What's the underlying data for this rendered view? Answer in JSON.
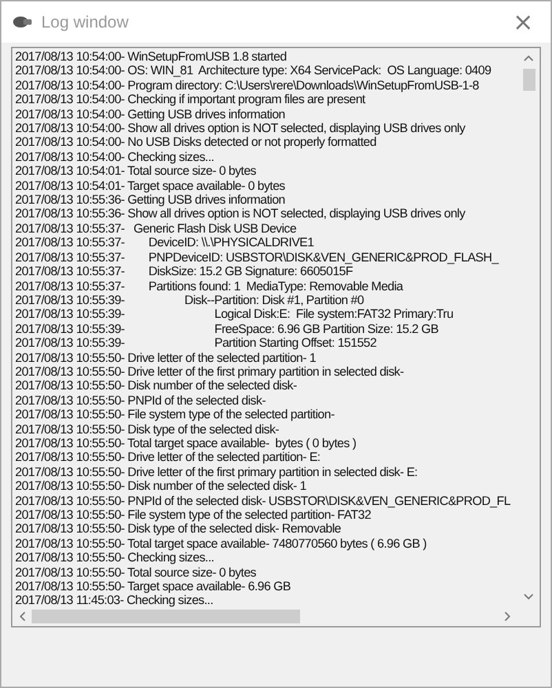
{
  "window": {
    "title": "Log window",
    "close_label": "×"
  },
  "log_lines": [
    "2017/08/13 10:54:00- WinSetupFromUSB 1.8 started",
    "2017/08/13 10:54:00- OS: WIN_81  Architecture type: X64 ServicePack:  OS Language: 0409",
    "2017/08/13 10:54:00- Program directory: C:\\Users\\rere\\Downloads\\WinSetupFromUSB-1-8",
    "2017/08/13 10:54:00- Checking if important program files are present",
    "2017/08/13 10:54:00- Getting USB drives information",
    "2017/08/13 10:54:00- Show all drives option is NOT selected, displaying USB drives only",
    "2017/08/13 10:54:00- No USB Disks detected or not properly formatted",
    "2017/08/13 10:54:00- Checking sizes...",
    "2017/08/13 10:54:01- Total source size- 0 bytes",
    "2017/08/13 10:54:01- Target space available- 0 bytes",
    "2017/08/13 10:55:36- Getting USB drives information",
    "2017/08/13 10:55:36- Show all drives option is NOT selected, displaying USB drives only",
    "2017/08/13 10:55:37-   Generic Flash Disk USB Device",
    "2017/08/13 10:55:37-        DeviceID: \\\\.\\PHYSICALDRIVE1",
    "2017/08/13 10:55:37-        PNPDeviceID: USBSTOR\\DISK&VEN_GENERIC&PROD_FLASH_",
    "2017/08/13 10:55:37-        DiskSize: 15.2 GB Signature: 6605015F",
    "2017/08/13 10:55:37-        Partitions found: 1  MediaType: Removable Media",
    "2017/08/13 10:55:39-                    Disk--Partition: Disk #1, Partition #0",
    "2017/08/13 10:55:39-                              Logical Disk:E:  File system:FAT32 Primary:Tru",
    "2017/08/13 10:55:39-                              FreeSpace: 6.96 GB Partition Size: 15.2 GB",
    "2017/08/13 10:55:39-                              Partition Starting Offset: 151552",
    "2017/08/13 10:55:50- Drive letter of the selected partition- 1",
    "2017/08/13 10:55:50- Drive letter of the first primary partition in selected disk-",
    "2017/08/13 10:55:50- Disk number of the selected disk-",
    "2017/08/13 10:55:50- PNPId of the selected disk-",
    "2017/08/13 10:55:50- File system type of the selected partition-",
    "2017/08/13 10:55:50- Disk type of the selected disk-",
    "2017/08/13 10:55:50- Total target space available-  bytes ( 0 bytes )",
    "2017/08/13 10:55:50- Drive letter of the selected partition- E:",
    "2017/08/13 10:55:50- Drive letter of the first primary partition in selected disk- E:",
    "2017/08/13 10:55:50- Disk number of the selected disk- 1",
    "2017/08/13 10:55:50- PNPId of the selected disk- USBSTOR\\DISK&VEN_GENERIC&PROD_FL",
    "2017/08/13 10:55:50- File system type of the selected partition- FAT32",
    "2017/08/13 10:55:50- Disk type of the selected disk- Removable",
    "2017/08/13 10:55:50- Total target space available- 7480770560 bytes ( 6.96 GB )",
    "2017/08/13 10:55:50- Checking sizes...",
    "2017/08/13 10:55:50- Total source size- 0 bytes",
    "2017/08/13 10:55:50- Target space available- 6.96 GB",
    "2017/08/13 11:45:03- Checking sizes..."
  ]
}
